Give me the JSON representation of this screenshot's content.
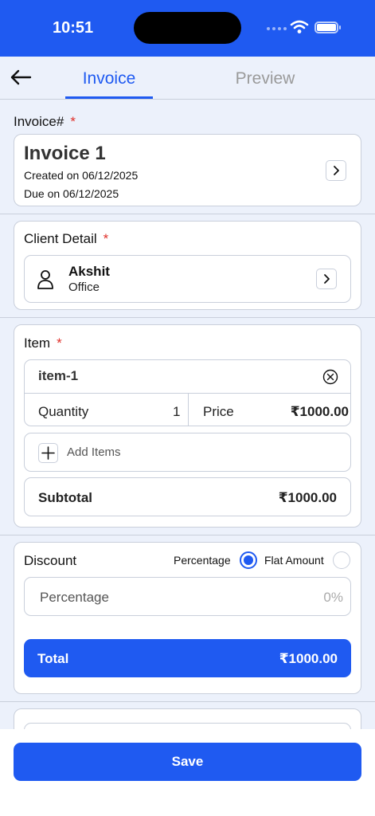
{
  "status_bar": {
    "time": "10:51"
  },
  "tabs": [
    {
      "label": "Invoice",
      "active": true
    },
    {
      "label": "Preview",
      "active": false
    }
  ],
  "invoice": {
    "label": "Invoice#",
    "required_mark": "*",
    "title": "Invoice 1",
    "created": "Created on 06/12/2025",
    "due": "Due on 06/12/2025"
  },
  "client": {
    "label": "Client Detail",
    "required_mark": "*",
    "name": "Akshit",
    "type": "Office"
  },
  "items": {
    "label": "Item",
    "required_mark": "*",
    "list": [
      {
        "name": "item-1",
        "quantity_label": "Quantity",
        "quantity": "1",
        "price_label": "Price",
        "price": "₹1000.00"
      }
    ],
    "add_label": "Add Items",
    "subtotal_label": "Subtotal",
    "subtotal": "₹1000.00"
  },
  "discount": {
    "label": "Discount",
    "option_percentage": "Percentage",
    "option_flat": "Flat Amount",
    "selected": "Percentage",
    "input_label": "Percentage",
    "input_placeholder": "0%"
  },
  "total": {
    "label": "Total",
    "value": "₹1000.00"
  },
  "actions": {
    "save_label": "Save"
  },
  "colors": {
    "accent": "#1f5af1",
    "required": "#e0302a",
    "background": "#ecf1fb"
  }
}
